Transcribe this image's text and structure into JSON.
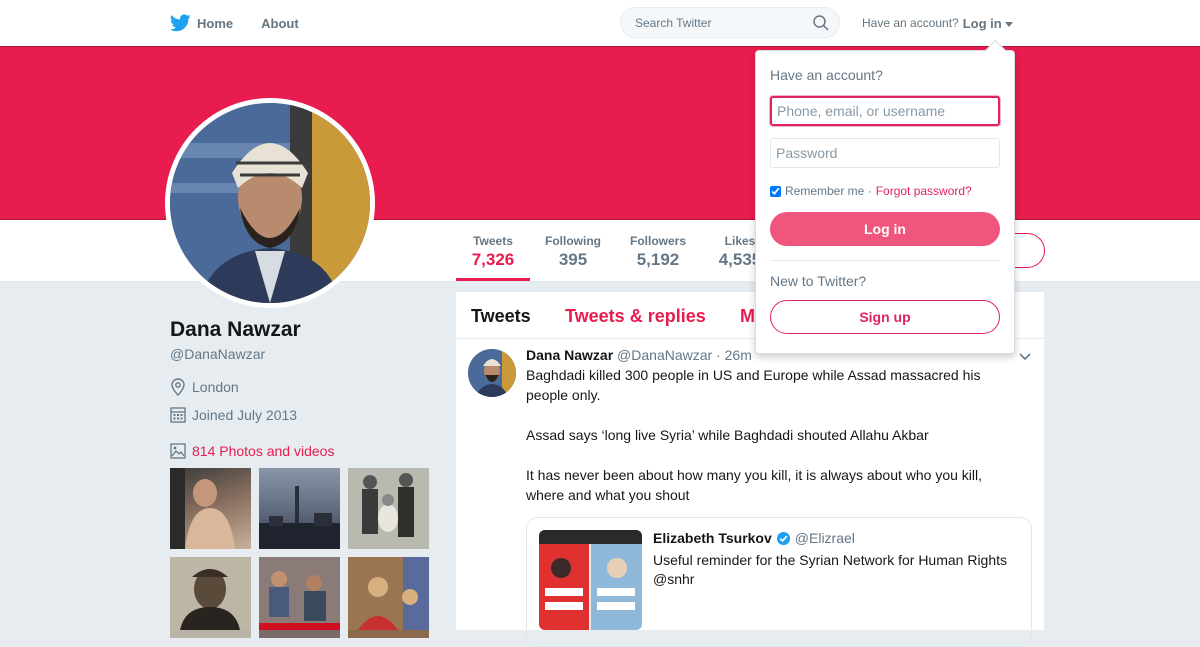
{
  "nav": {
    "home_label": "Home",
    "about_label": "About",
    "search_placeholder": "Search Twitter",
    "account_prompt": "Have an account?",
    "login_label": "Log in"
  },
  "colors": {
    "brand": "#1da1f2",
    "accent": "#e81c4f",
    "banner": "#e81c4f"
  },
  "profile": {
    "name": "Dana Nawzar",
    "handle": "@DanaNawzar",
    "location": "London",
    "joined": "Joined July 2013",
    "photos_label": "814 Photos and videos"
  },
  "stats": [
    {
      "label": "Tweets",
      "value": "7,326"
    },
    {
      "label": "Following",
      "value": "395"
    },
    {
      "label": "Followers",
      "value": "5,192"
    },
    {
      "label": "Likes",
      "value": "4,535"
    }
  ],
  "timeline": {
    "tabs": [
      "Tweets",
      "Tweets & replies",
      "M"
    ]
  },
  "tweet": {
    "name": "Dana Nawzar",
    "handle": "@DanaNawzar",
    "time": "· 26m",
    "paragraphs": [
      "Baghdadi killed 300 people in US and Europe while Assad massacred his people only.",
      "Assad says ‘long live Syria’ while Baghdadi shouted Allahu Akbar",
      "It has never been about how many you kill, it is always about who you kill, where and what you shout"
    ],
    "quote": {
      "name": "Elizabeth Tsurkov",
      "handle": "@Elizrael",
      "text": "Useful reminder for the Syrian Network for Human Rights @snhr"
    }
  },
  "login_dropdown": {
    "title": "Have an account?",
    "username_placeholder": "Phone, email, or username",
    "password_placeholder": "Password",
    "remember_label": "Remember me ·",
    "forgot_label": "Forgot password?",
    "login_button": "Log in",
    "new_prompt": "New to Twitter?",
    "signup_button": "Sign up"
  }
}
